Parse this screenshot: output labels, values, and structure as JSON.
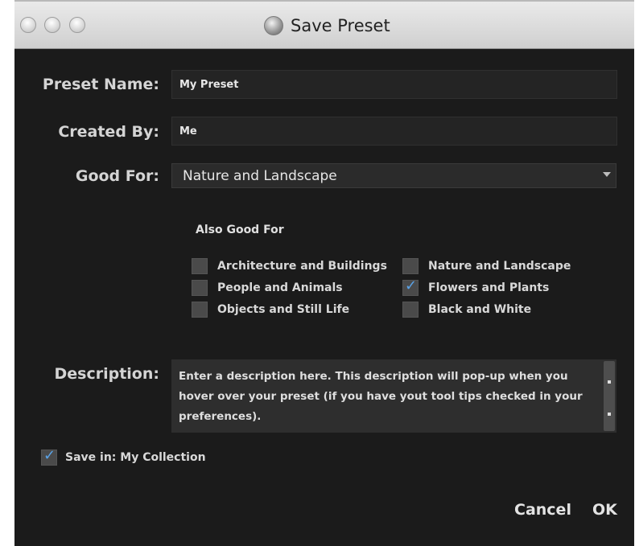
{
  "window": {
    "title": "Save Preset",
    "icon": "app-globe-icon"
  },
  "form": {
    "preset_name_label": "Preset Name:",
    "preset_name_value": "My Preset",
    "created_by_label": "Created By:",
    "created_by_value": "Me",
    "good_for_label": "Good For:",
    "good_for_selected": "Nature and Landscape",
    "also_good_for_label": "Also Good For",
    "also_good_for": [
      {
        "label": "Architecture and Buildings",
        "checked": false
      },
      {
        "label": "Nature and Landscape",
        "checked": false
      },
      {
        "label": "People and Animals",
        "checked": false
      },
      {
        "label": "Flowers and Plants",
        "checked": true
      },
      {
        "label": "Objects and Still Life",
        "checked": false
      },
      {
        "label": "Black and White",
        "checked": false
      }
    ],
    "description_label": "Description:",
    "description_value": "Enter a description here.  This description will pop-up when you hover over your preset (if you have yout tool tips checked in your preferences).",
    "save_in_label": "Save in: My Collection",
    "save_in_checked": true
  },
  "buttons": {
    "cancel": "Cancel",
    "ok": "OK"
  },
  "colors": {
    "background": "#1b1b1b",
    "checkmark": "#5aa2e6"
  }
}
